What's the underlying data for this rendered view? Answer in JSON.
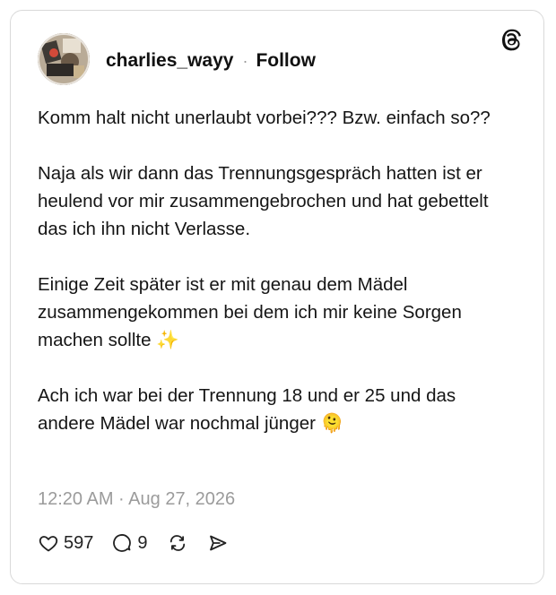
{
  "post": {
    "username": "charlies_wayy",
    "separator": "·",
    "follow_label": "Follow",
    "paragraphs": [
      "Komm halt nicht unerlaubt vorbei??? Bzw. einfach so??",
      "Naja als wir dann das Trennungsgespräch hatten ist er heulend vor mir zusammengebrochen und hat gebettelt das ich ihn nicht Verlasse.",
      "Einige Zeit später ist er mit genau dem Mädel zusammengekommen bei dem ich mir keine Sorgen machen sollte ✨",
      "Ach ich war bei der Trennung 18 und er 25 und das andere Mädel war nochmal jünger 🫠"
    ],
    "timestamp": "12:20 AM · Aug 27, 2026"
  },
  "actions": {
    "likes": "597",
    "replies": "9"
  },
  "icons": {
    "logo": "threads-logo-icon",
    "like": "heart-icon",
    "reply": "comment-icon",
    "repost": "repost-icon",
    "share": "share-icon"
  }
}
